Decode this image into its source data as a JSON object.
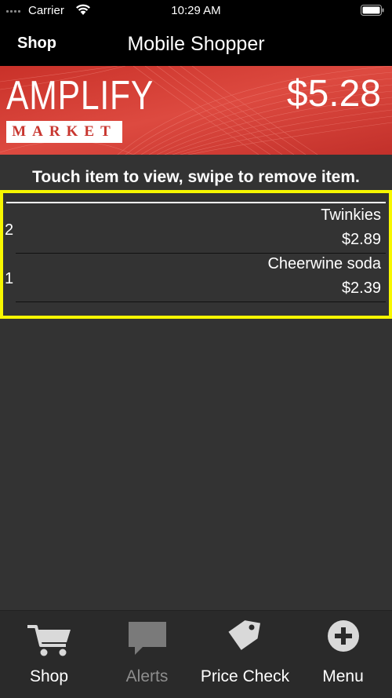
{
  "status_bar": {
    "carrier": "Carrier",
    "time": "10:29 AM"
  },
  "nav": {
    "back_label": "Shop",
    "title": "Mobile Shopper"
  },
  "banner": {
    "logo_top": "AMPLIFY",
    "logo_bottom": "MARKET",
    "total": "$5.28"
  },
  "instruction": "Touch item to view, swipe to remove item.",
  "cart": {
    "items": [
      {
        "quantity": "2",
        "name": "Twinkies",
        "price": "$2.89"
      },
      {
        "quantity": "1",
        "name": "Cheerwine soda",
        "price": "$2.39"
      }
    ]
  },
  "tab_bar": {
    "tabs": [
      {
        "label": "Shop",
        "icon": "cart-icon",
        "active": true
      },
      {
        "label": "Alerts",
        "icon": "chat-bubble-icon",
        "active": false
      },
      {
        "label": "Price Check",
        "icon": "price-tag-icon",
        "active": true
      },
      {
        "label": "Menu",
        "icon": "plus-circle-icon",
        "active": true
      }
    ]
  },
  "colors": {
    "banner_red": "#d33a32",
    "highlight_yellow": "#f7f700",
    "background": "#333333",
    "tab_bar": "#2a2a2a"
  }
}
